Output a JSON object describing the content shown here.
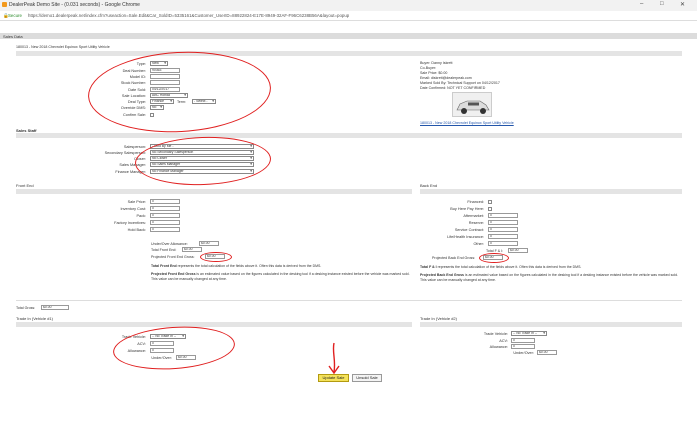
{
  "window": {
    "title": "DealerPeak Demo Site - (0.031 seconds) - Google Chrome",
    "secure_label": "Secure",
    "url": "https://demo1.dealerpeak.net/index.cfm?useaction=Sale.Edit&Car_SoldID=5335161&Customer_UserID=88922824-E17E-8949-32AF-F96C6238B56A&layout=popup"
  },
  "page": {
    "sales_data_header": "Sales Data",
    "vehicle_title": "180013 - New 2018 Chevrolet Equinox Sport Utility Vehicle"
  },
  "deal": {
    "type_label": "Type:",
    "type_value": "New",
    "deal_number_label": "Deal Number:",
    "deal_number_value": "90363",
    "model_id_label": "Model ID:",
    "model_id_value": "",
    "stock_number_label": "Stock Number:",
    "stock_number_value": "",
    "date_sold_label": "Date Sold:",
    "date_sold_value": "04/12/2017",
    "sale_location_label": "Sale Location:",
    "sale_location_value": "ABC Honda",
    "deal_type_label": "Deal Type:",
    "deal_type_value": "Finance",
    "term_label": "Term:",
    "term_value": "- Select -",
    "override_dms_label": "Override DMS:",
    "override_dms_value": "No",
    "confirm_sale_label": "Confirm Sale:"
  },
  "buyer": {
    "buyer_line": "Buyer: Danny Iskrett",
    "cobuyer_line": "Co-Buyer:",
    "sale_price_line": "Sale Price: $0.00",
    "email_line": "Email: diskrett@dealerpeak.com",
    "marked_sold_line": "Marked Sold By: Technical Support on 04/12/2017",
    "date_confirmed_line": "Date Confirmed: NOT YET CONFIRMED",
    "vehicle_link": "180013 - New 2018 Chevrolet Equinox Sport Utility Vehicle"
  },
  "sales_staff": {
    "header": "Sales Staff",
    "salesperson_label": "Salesperson:",
    "salesperson_value": "- Sold By Me -",
    "secondary_label": "Secondary Salesperson:",
    "secondary_value": "No Secondary Salesperson",
    "closer_label": "Closer:",
    "closer_value": "No Closer",
    "sales_manager_label": "Sales Manager:",
    "sales_manager_value": "No Sales Manager",
    "finance_manager_label": "Finance Manager:",
    "finance_manager_value": "No Finance Manager"
  },
  "front_end": {
    "header": "Front End",
    "sale_price_label": "Sale Price:",
    "sale_price_value": "0",
    "inventory_cost_label": "Inventory Cost:",
    "inventory_cost_value": "0",
    "pack_label": "Pack:",
    "pack_value": "0",
    "factory_incentives_label": "Factory Incentives:",
    "factory_incentives_value": "0",
    "hold_back_label": "Hold Back:",
    "hold_back_value": "0",
    "under_over_label": "Under/Over Allowance:",
    "under_over_value": "$0.00",
    "total_front_label": "Total Front End:",
    "total_front_value": "$0.00",
    "projected_label": "Projected Front End Gross:",
    "projected_value": "$0.00",
    "para1_bold": "Total Front End",
    "para1_rest": " represents the total calculation of the fields above it. Often this data is derived from the DMS.",
    "para2_bold": "Projected Front End Gross",
    "para2_rest": " is an estimated value based on the figures calculated in the desking tool if a desking instance existed before the vehicle was marked sold. This value can be manually changed at any time."
  },
  "back_end": {
    "header": "Back End",
    "financed_label": "Financed:",
    "buy_here_label": "Buy Here Pay Here:",
    "aftermarket_label": "Aftermarket:",
    "aftermarket_value": "0",
    "reserve_label": "Reserve:",
    "reserve_value": "0",
    "service_label": "Service Contract:",
    "service_value": "0",
    "life_label": "Life/Health Insurance:",
    "life_value": "0",
    "other_label": "Other:",
    "other_value": "0",
    "total_fi_label": "Total F & I:",
    "total_fi_value": "$0.00",
    "projected_label": "Projected Back End Gross:",
    "projected_value": "$0.00",
    "para1_bold": "Total F & I",
    "para1_rest": " represents the total calculation of the fields above it. Often this data is derived from the DMS.",
    "para2_bold": "Projected Back End Gross",
    "para2_rest": " is an estimated value based on the figures calculated in the desking tool if a desking instance existed before the vehicle was marked sold. This value can be manually changed at any time."
  },
  "total_gross": {
    "label": "Total Gross:",
    "value": "$0.00"
  },
  "trade1": {
    "header": "Trade In (Vehicle #1)",
    "vehicle_label": "Trade Vehicle:",
    "vehicle_value": "-- No Trade In --",
    "acv_label": "ACV:",
    "acv_value": "0",
    "allowance_label": "Allowance:",
    "allowance_value": "0",
    "under_over_label": "Under/Over:",
    "under_over_value": "$0.00"
  },
  "trade2": {
    "header": "Trade In (Vehicle #2)",
    "vehicle_label": "Trade Vehicle:",
    "vehicle_value": "-- No Trade In --",
    "acv_label": "ACV:",
    "acv_value": "0",
    "allowance_label": "Allowance:",
    "allowance_value": "0",
    "under_over_label": "Under/Over:",
    "under_over_value": "$0.00"
  },
  "actions": {
    "update_sale": "Update Sale",
    "unsold_sale": "Unsold Sale"
  },
  "colors": {
    "annotation_red": "#e02020",
    "update_button": "#f4e25a",
    "section_bar": "#e4e4e4"
  }
}
